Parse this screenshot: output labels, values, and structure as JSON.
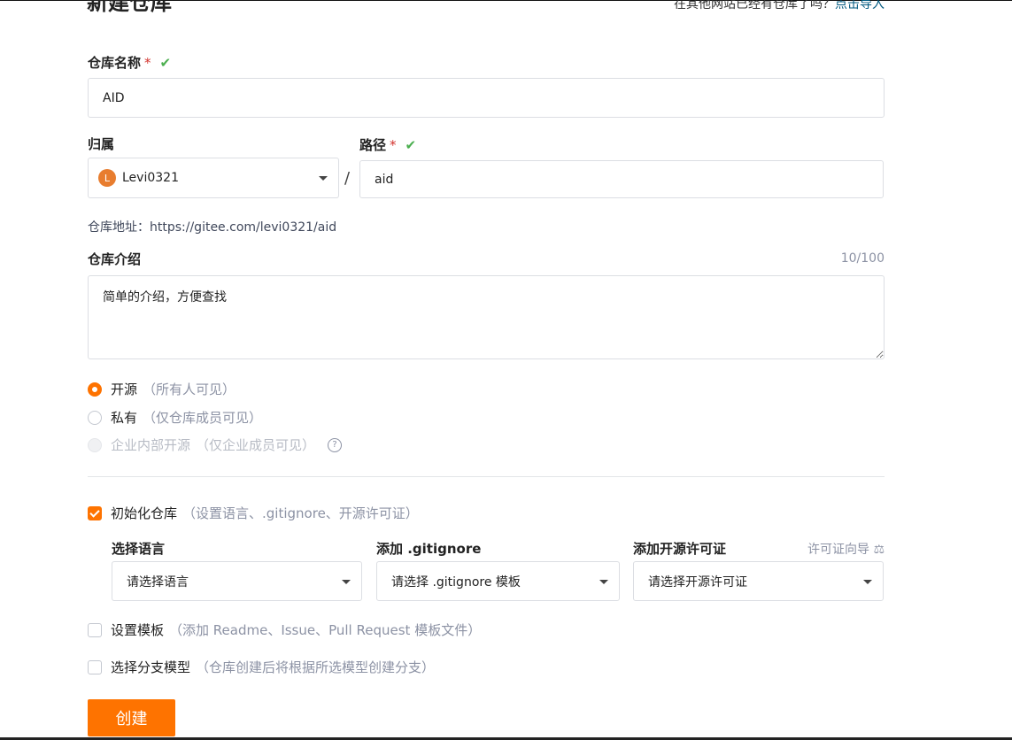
{
  "header": {
    "title": "新建仓库",
    "import_hint": "在其他网站已经有仓库了吗？",
    "import_link": "点击导入"
  },
  "repo_name": {
    "label": "仓库名称",
    "required_mark": "*",
    "valid_mark": "✔",
    "value": "AID"
  },
  "owner": {
    "label": "归属",
    "avatar_letter": "L",
    "value": "Levi0321"
  },
  "separator": "/",
  "path": {
    "label": "路径",
    "required_mark": "*",
    "valid_mark": "✔",
    "value": "aid"
  },
  "repo_address": "仓库地址：https://gitee.com/levi0321/aid",
  "description": {
    "label": "仓库介绍",
    "counter": "10/100",
    "value": "简单的介绍，方便查找"
  },
  "visibility": [
    {
      "label": "开源",
      "hint": "（所有人可见）",
      "state": "selected"
    },
    {
      "label": "私有",
      "hint": "（仅仓库成员可见）",
      "state": "unselected"
    },
    {
      "label": "企业内部开源",
      "hint": "（仅企业成员可见）",
      "state": "disabled",
      "help_icon": "?"
    }
  ],
  "init_repo": {
    "label": "初始化仓库",
    "hint": "（设置语言、.gitignore、开源许可证）",
    "checked": true
  },
  "language": {
    "label": "选择语言",
    "placeholder": "请选择语言"
  },
  "gitignore": {
    "label": "添加 .gitignore",
    "placeholder": "请选择 .gitignore 模板"
  },
  "license": {
    "label": "添加开源许可证",
    "guide": "许可证向导",
    "guide_icon": "⚖",
    "placeholder": "请选择开源许可证"
  },
  "template": {
    "label": "设置模板",
    "hint": "（添加 Readme、Issue、Pull Request 模板文件）",
    "checked": false
  },
  "branch_model": {
    "label": "选择分支模型",
    "hint": "（仓库创建后将根据所选模型创建分支）",
    "checked": false
  },
  "submit": {
    "label": "创建"
  },
  "colors": {
    "accent": "#fe7300",
    "valid": "#4caf50",
    "required": "#d2322d",
    "link": "#005980"
  }
}
